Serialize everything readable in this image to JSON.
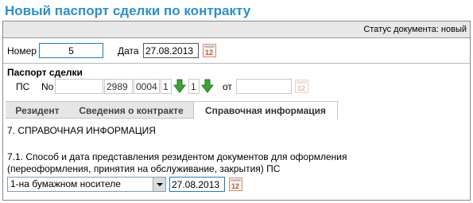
{
  "page": {
    "title": "Новый паспорт сделки по контракту"
  },
  "status": {
    "text": "Статус документа: новый"
  },
  "header_fields": {
    "number_label": "Номер",
    "number_value": "5",
    "date_label": "Дата",
    "date_value": "27.08.2013"
  },
  "passport": {
    "heading": "Паспорт сделки",
    "ps_label": "ПС",
    "no_label": "No",
    "part1": "",
    "part2": "2989",
    "part3": "0004",
    "part4": "1",
    "part5": "1",
    "from_label": "от",
    "from_value": ""
  },
  "tabs": [
    {
      "label": "Резидент",
      "active": false
    },
    {
      "label": "Сведения о контракте",
      "active": false
    },
    {
      "label": "Справочная информация",
      "active": true
    }
  ],
  "section": {
    "heading": "7. СПРАВОЧНАЯ ИНФОРМАЦИЯ",
    "q_line1": "7.1. Способ и дата представления резидентом документов для оформления",
    "q_line2": "(переоформления, принятия на обслуживание, закрытия) ПС",
    "method_selected": "1-на бумажном носителе",
    "method_date": "27.08.2013"
  },
  "calendar_icon_text": "12",
  "colors": {
    "title": "#2a8fd0",
    "arrow": "#3aa332"
  }
}
